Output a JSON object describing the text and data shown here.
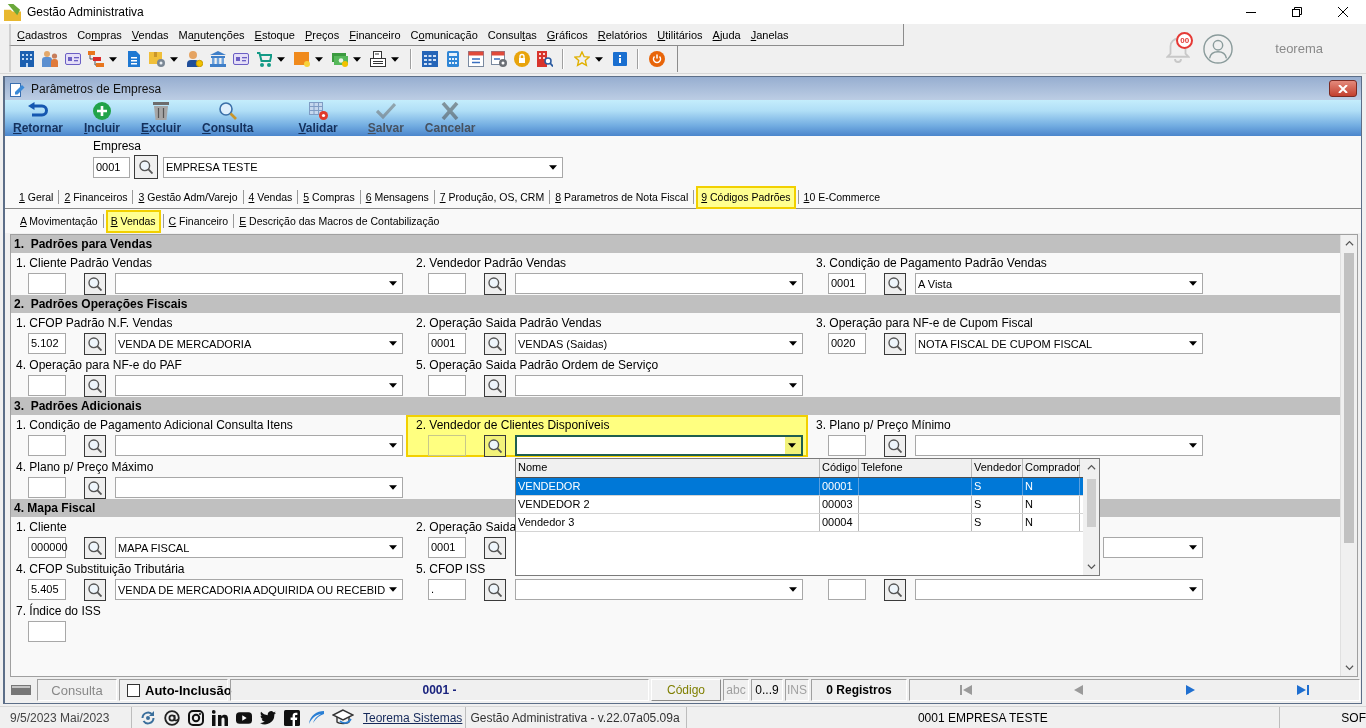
{
  "app": {
    "title": "Gestão Administrativa",
    "menu": [
      {
        "label": "Cadastros"
      },
      {
        "label": "Compras"
      },
      {
        "label": "Vendas"
      },
      {
        "label": "Manutenções"
      },
      {
        "label": "Estoque"
      },
      {
        "label": "Preços"
      },
      {
        "label": "Financeiro"
      },
      {
        "label": "Comunicação"
      },
      {
        "label": "Consultas"
      },
      {
        "label": "Gráficos"
      },
      {
        "label": "Relatórios"
      },
      {
        "label": "Utilitários"
      },
      {
        "label": "Ajuda"
      },
      {
        "label": "Janelas"
      }
    ],
    "notifications": "00",
    "user": "teorema"
  },
  "window": {
    "title": "Parâmetros de Empresa",
    "toolbar": [
      {
        "label": "Retornar",
        "disabled": false
      },
      {
        "label": "Incluir",
        "disabled": false
      },
      {
        "label": "Excluir",
        "disabled": false
      },
      {
        "label": "Consulta",
        "disabled": false
      },
      {
        "label": "Validar",
        "disabled": false
      },
      {
        "label": "Salvar",
        "disabled": true
      },
      {
        "label": "Cancelar",
        "disabled": true
      }
    ]
  },
  "company": {
    "label": "Empresa",
    "code": "0001",
    "name": "EMPRESA TESTE"
  },
  "tabs": [
    {
      "label": "1 Geral",
      "selected": false
    },
    {
      "label": "2 Financeiros",
      "selected": false
    },
    {
      "label": "3 Gestão Adm/Varejo",
      "selected": false
    },
    {
      "label": "4 Vendas",
      "selected": false
    },
    {
      "label": "5 Compras",
      "selected": false
    },
    {
      "label": "6 Mensagens",
      "selected": false
    },
    {
      "label": "7 Produção, OS, CRM",
      "selected": false
    },
    {
      "label": "8 Parametros de Nota Fiscal",
      "selected": false
    },
    {
      "label": "9 Códigos Padrões",
      "selected": true
    },
    {
      "label": "10 E-Commerce",
      "selected": false
    }
  ],
  "subtabs": [
    {
      "label": "A Movimentação",
      "selected": false
    },
    {
      "label": "B Vendas",
      "selected": true
    },
    {
      "label": "C Financeiro",
      "selected": false
    },
    {
      "label": "E Descrição das Macros de Contabilização",
      "selected": false
    }
  ],
  "sections": [
    {
      "title": "1.  Padrões para Vendas",
      "rows": [
        {
          "fields": [
            {
              "kind": "lookup",
              "label": "1. Cliente Padrão Vendas",
              "focused": false
            },
            {
              "kind": "lookup",
              "label": "2. Vendedor Padrão Vendas",
              "focused": false
            },
            {
              "kind": "lookup",
              "label": "3. Condição de Pagamento Padrão Vendas",
              "code": "0001",
              "value": "A Vista",
              "focused": false
            }
          ]
        }
      ]
    },
    {
      "title": "2.  Padrões Operações Fiscais",
      "rows": [
        {
          "fields": [
            {
              "kind": "lookup",
              "label": "1. CFOP Padrão N.F. Vendas",
              "code": "5.102",
              "value": "VENDA DE MERCADORIA",
              "focused": false
            },
            {
              "kind": "lookup",
              "label": "2. Operação Saida Padrão Vendas",
              "code": "0001",
              "value": "VENDAS (Saidas)",
              "focused": false
            },
            {
              "kind": "lookup",
              "label": "3. Operação para NF-e de Cupom Fiscal",
              "code": "0020",
              "value": "NOTA FISCAL DE CUPOM FISCAL",
              "focused": false
            }
          ]
        },
        {
          "fields": [
            {
              "kind": "lookup",
              "label": "4. Operação para NF-e do PAF",
              "focused": false
            },
            {
              "kind": "lookup",
              "label": "5. Operação Saida Padrão Ordem de Serviço",
              "focused": false
            }
          ]
        }
      ]
    },
    {
      "title": "3.  Padrões Adicionais",
      "rows": [
        {
          "fields": [
            {
              "kind": "lookup",
              "label": "1. Condição de Pagamento Adicional Consulta Itens",
              "focused": false
            },
            {
              "kind": "lookup",
              "label": "2. Vendedor de Clientes Disponíveis",
              "focused": true,
              "popup": {
                "columns": [
                  "Nome",
                  "Código",
                  "Telefone",
                  "Vendedor",
                  "Comprador"
                ],
                "rows": [
                  {
                    "cells": [
                      "VENDEDOR",
                      "00001",
                      null,
                      "S",
                      "N"
                    ],
                    "selected": true
                  },
                  {
                    "cells": [
                      "VENDEDOR 2",
                      "00003",
                      null,
                      "S",
                      "N"
                    ],
                    "selected": false
                  },
                  {
                    "cells": [
                      "Vendedor 3",
                      "00004",
                      null,
                      "S",
                      "N"
                    ],
                    "selected": false
                  }
                ]
              }
            },
            {
              "kind": "lookup",
              "label": "3. Plano p/ Preço Mínimo",
              "focused": false
            }
          ]
        },
        {
          "fields": [
            {
              "kind": "lookup",
              "label": "4. Plano p/ Preço Máximo",
              "focused": false
            }
          ]
        }
      ]
    },
    {
      "title": "4. Mapa Fiscal",
      "rows": [
        {
          "fields": [
            {
              "kind": "lookup",
              "label": "1. Cliente",
              "code": "000000",
              "value": "MAPA FISCAL",
              "focused": false
            },
            {
              "kind": "code_search",
              "label": "2. Operação Saida",
              "code": "0001",
              "focused": false
            },
            {
              "kind": "select",
              "focused": false
            }
          ]
        },
        {
          "fields": [
            {
              "kind": "lookup",
              "label": "4. CFOP Substituição Tributária",
              "code": "5.405",
              "value": "VENDA DE MERCADORIA ADQUIRIDA OU RECEBID",
              "focused": false
            },
            {
              "kind": "lookup",
              "label": "5. CFOP ISS",
              "code": ".",
              "focused": false
            },
            {
              "kind": "lookup",
              "focused": false
            }
          ]
        },
        {
          "fields": [
            {
              "kind": "code",
              "label": "7. Índice do ISS",
              "focused": false
            }
          ]
        }
      ]
    }
  ],
  "status_bar": {
    "mode": "Consulta",
    "auto_inclusion": {
      "label": "Auto-Inclusão",
      "checked": false
    },
    "record": "0001 -",
    "key_field": "Código",
    "indicators": [
      {
        "label": "abc",
        "active": false
      },
      {
        "label": "0...9",
        "active": true
      },
      {
        "label": "INS",
        "active": false
      }
    ],
    "count": "0 Registros",
    "nav": [
      {
        "kind": "first",
        "disabled": true
      },
      {
        "kind": "previous",
        "disabled": true
      },
      {
        "kind": "next",
        "disabled": false
      },
      {
        "kind": "last",
        "disabled": false
      }
    ]
  },
  "app_status": {
    "date": "9/5/2023 Mai/2023",
    "link": "Teorema Sistemas",
    "version": "Gestão Administrativa - v.22.07a05.09a",
    "company": "0001 EMPRESA TESTE",
    "extra": "SOF"
  }
}
